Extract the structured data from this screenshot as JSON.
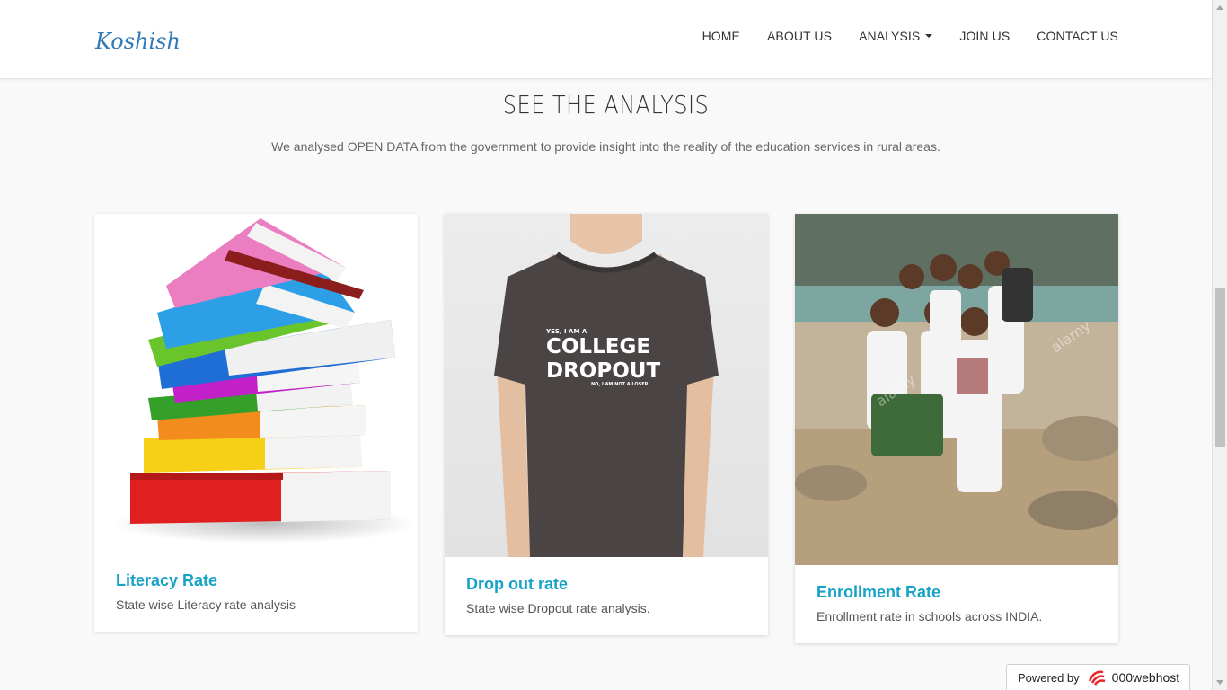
{
  "navbar": {
    "brand": "Koshish",
    "items": [
      {
        "label": "HOME"
      },
      {
        "label": "ABOUT US"
      },
      {
        "label": "ANALYSIS",
        "has_caret": true
      },
      {
        "label": "JOIN US"
      },
      {
        "label": "CONTACT US"
      }
    ]
  },
  "section": {
    "title": "SEE THE ANALYSIS",
    "subtitle": "We analysed OPEN DATA from the government to provide insight into the reality of the education services in rural areas."
  },
  "cards": [
    {
      "title": "Literacy Rate",
      "text": "State wise Literacy rate analysis",
      "image": "stack-of-books"
    },
    {
      "title": "Drop out rate",
      "text": "State wise Dropout rate analysis.",
      "image": "college-dropout-tshirt",
      "shirt": {
        "small_top": "YES, I AM A",
        "line1": "COLLEGE",
        "line2": "DROPOUT",
        "small_bottom": "NO, I AM NOT A LOSER"
      }
    },
    {
      "title": "Enrollment Rate",
      "text": "Enrollment rate in schools across INDIA.",
      "image": "school-children",
      "watermark": "alamy"
    }
  ],
  "powered": {
    "prefix": "Powered by",
    "host": "000webhost"
  },
  "colors": {
    "brand": "#337ab7",
    "card_title": "#17a2c7",
    "background": "#f9f9f9"
  }
}
